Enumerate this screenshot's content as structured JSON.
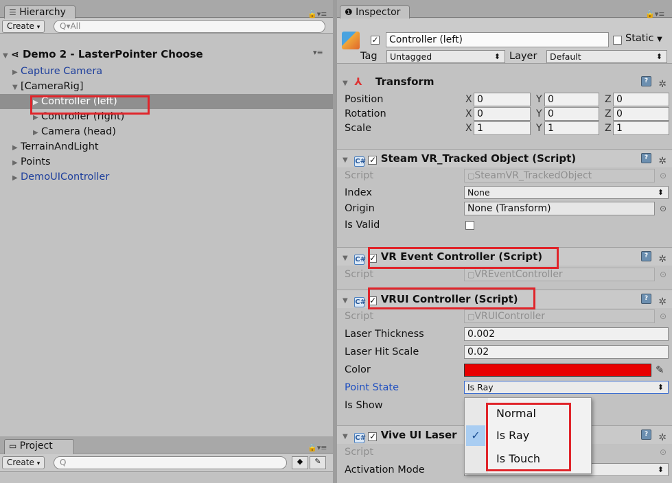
{
  "hierarchy": {
    "tab_label": "Hierarchy",
    "create_label": "Create",
    "search_placeholder": "Q▾All",
    "scene_name": "Demo 2 - LasterPointer Choose",
    "items": [
      {
        "label": "Capture Camera"
      },
      {
        "label": "[CameraRig]"
      },
      {
        "label": "Controller (left)"
      },
      {
        "label": "Controller (right)"
      },
      {
        "label": "Camera (head)"
      },
      {
        "label": "TerrainAndLight"
      },
      {
        "label": "Points"
      },
      {
        "label": "DemoUIController"
      }
    ]
  },
  "project": {
    "tab_label": "Project",
    "create_label": "Create",
    "search_placeholder": "Q"
  },
  "inspector": {
    "tab_label": "Inspector",
    "object_name": "Controller (left)",
    "static_label": "Static",
    "tag_label": "Tag",
    "tag_value": "Untagged",
    "layer_label": "Layer",
    "layer_value": "Default",
    "transform": {
      "title": "Transform",
      "rows": [
        {
          "label": "Position",
          "x": "0",
          "y": "0",
          "z": "0"
        },
        {
          "label": "Rotation",
          "x": "0",
          "y": "0",
          "z": "0"
        },
        {
          "label": "Scale",
          "x": "1",
          "y": "1",
          "z": "1"
        }
      ],
      "axis_x": "X",
      "axis_y": "Y",
      "axis_z": "Z"
    },
    "tracked": {
      "title": "Steam VR_Tracked Object (Script)",
      "script_label": "Script",
      "script_value": "SteamVR_TrackedObject",
      "index_label": "Index",
      "index_value": "None",
      "origin_label": "Origin",
      "origin_value": "None (Transform)",
      "valid_label": "Is Valid"
    },
    "event": {
      "title": "VR Event Controller (Script)",
      "script_label": "Script",
      "script_value": "VREventController"
    },
    "vrui": {
      "title": "VRUI Controller (Script)",
      "script_label": "Script",
      "script_value": "VRUIController",
      "thickness_label": "Laser Thickness",
      "thickness_value": "0.002",
      "hitscale_label": "Laser Hit Scale",
      "hitscale_value": "0.02",
      "color_label": "Color",
      "color_value": "#e80000",
      "pointstate_label": "Point State",
      "pointstate_value": "Is Ray",
      "isshow_label": "Is Show"
    },
    "vive": {
      "title": "Vive UI Laser",
      "script_label": "Script",
      "activation_label": "Activation Mode"
    },
    "popup": {
      "options": [
        "Normal",
        "Is Ray",
        "Is Touch"
      ],
      "check": "✓"
    }
  }
}
